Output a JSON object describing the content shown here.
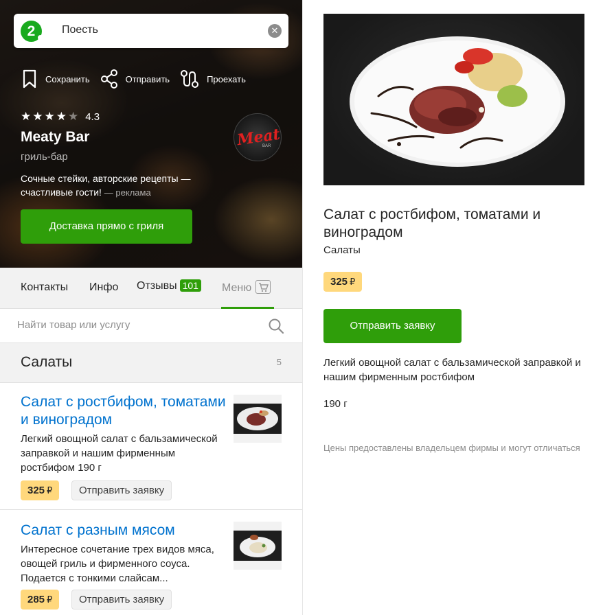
{
  "search": {
    "value": "Поесть",
    "clear_icon": "close-icon"
  },
  "actions": {
    "save": "Сохранить",
    "share": "Отправить",
    "route": "Проехать"
  },
  "firm": {
    "rating": "4.3",
    "stars_filled": 4,
    "name": "Meaty Bar",
    "rubric": "гриль-бар",
    "logo_text": "Meaty",
    "logo_sub": "BAR",
    "promo": "Сочные стейки, авторские рецепты — счастливые гости!",
    "promo_ad": "— реклама",
    "cta": "Доставка прямо с гриля"
  },
  "tabs": {
    "contacts": "Контакты",
    "info": "Инфо",
    "reviews": "Отзывы",
    "reviews_count": "101",
    "menu": "Меню"
  },
  "menu_search": {
    "placeholder": "Найти товар или услугу"
  },
  "category": {
    "title": "Салаты",
    "count": "5"
  },
  "items": [
    {
      "title": "Салат с ростбифом, томатами и виноградом",
      "desc": "Легкий овощной салат с бальзамической заправкой и нашим фирменным ростбифом 190 г",
      "price": "325",
      "currency": "₽",
      "button": "Отправить заявку"
    },
    {
      "title": "Салат с разным мясом",
      "desc": "Интересное сочетание трех видов мяса, овощей гриль и фирменного соуса. Подается с тонкими слайсам...",
      "price": "285",
      "currency": "₽",
      "button": "Отправить заявку"
    }
  ],
  "detail": {
    "title": "Салат с ростбифом, томатами и виноградом",
    "category": "Салаты",
    "price": "325",
    "currency": "₽",
    "button": "Отправить заявку",
    "desc": "Легкий овощной салат с бальзамической заправкой и нашим фирменным ростбифом",
    "weight": "190 г",
    "note": "Цены предоставлены владельцем фирмы и могут отличаться"
  },
  "colors": {
    "accent_green": "#2f9e0a",
    "link_blue": "#0072ce",
    "price_bg": "#ffd87c"
  }
}
